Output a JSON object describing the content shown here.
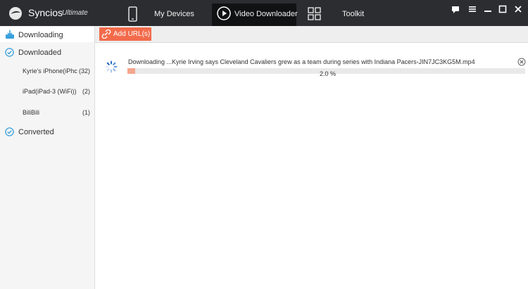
{
  "app": {
    "name": "Syncios",
    "edition": "Ultimate"
  },
  "nav": {
    "tabs": [
      {
        "label": "My Devices",
        "icon": "phone-icon"
      },
      {
        "label": "Video Downloader",
        "icon": "play-circle-icon",
        "active": true
      },
      {
        "label": "Toolkit",
        "icon": "toolkit-grid-icon"
      }
    ]
  },
  "window_controls": [
    "chat-icon",
    "menu-icon",
    "minimize-icon",
    "maximize-icon",
    "close-icon"
  ],
  "toolbar": {
    "add_url_label": "Add URL(s)"
  },
  "sidebar": {
    "downloading": "Downloading",
    "downloaded": "Downloaded",
    "devices": [
      {
        "name": "Kyrie's iPhone(iPhc",
        "count": "(32)"
      },
      {
        "name": "iPad(iPad-3 (WiFi))",
        "count": "(2)"
      },
      {
        "name": "BiliBili",
        "count": "(1)"
      }
    ],
    "converted": "Converted"
  },
  "download": {
    "status": "Downloading ...",
    "filename": "Kyrie Irving says Cleveland Cavaliers grew as a team during series with Indiana Pacers-JIN7JC3KG5M.mp4",
    "progress_text": "2.0 %",
    "progress_fraction": 0.02
  },
  "colors": {
    "accent": "#f26b4b",
    "titlebar": "#2b2d30",
    "check": "#3aa0dc",
    "progress": "#f4a78f"
  }
}
